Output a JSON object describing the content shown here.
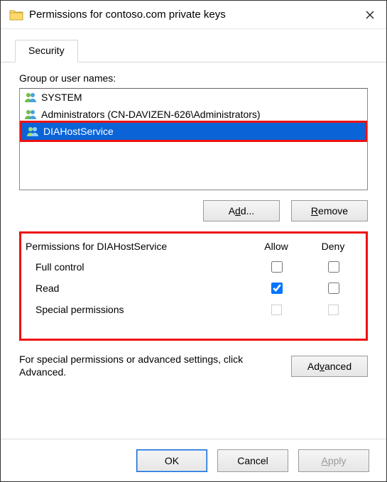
{
  "window": {
    "title": "Permissions for contoso.com private keys"
  },
  "tab": {
    "security": "Security"
  },
  "groupsLabel": "Group or user names:",
  "users": [
    {
      "name": "SYSTEM",
      "selected": false,
      "iconType": "group"
    },
    {
      "name": "Administrators (CN-DAVIZEN-626\\Administrators)",
      "selected": false,
      "iconType": "group"
    },
    {
      "name": "DIAHostService",
      "selected": true,
      "iconType": "user"
    }
  ],
  "buttons": {
    "add": "Add...",
    "remove": "Remove",
    "advanced": "Advanced",
    "ok": "OK",
    "cancel": "Cancel",
    "apply": "Apply"
  },
  "permHeader": {
    "title": "Permissions for DIAHostService",
    "allow": "Allow",
    "deny": "Deny"
  },
  "permissions": [
    {
      "name": "Full control",
      "allow": false,
      "deny": false,
      "disabled": false
    },
    {
      "name": "Read",
      "allow": true,
      "deny": false,
      "disabled": false
    },
    {
      "name": "Special permissions",
      "allow": false,
      "deny": false,
      "disabled": true
    }
  ],
  "advText": "For special permissions or advanced settings, click Advanced."
}
